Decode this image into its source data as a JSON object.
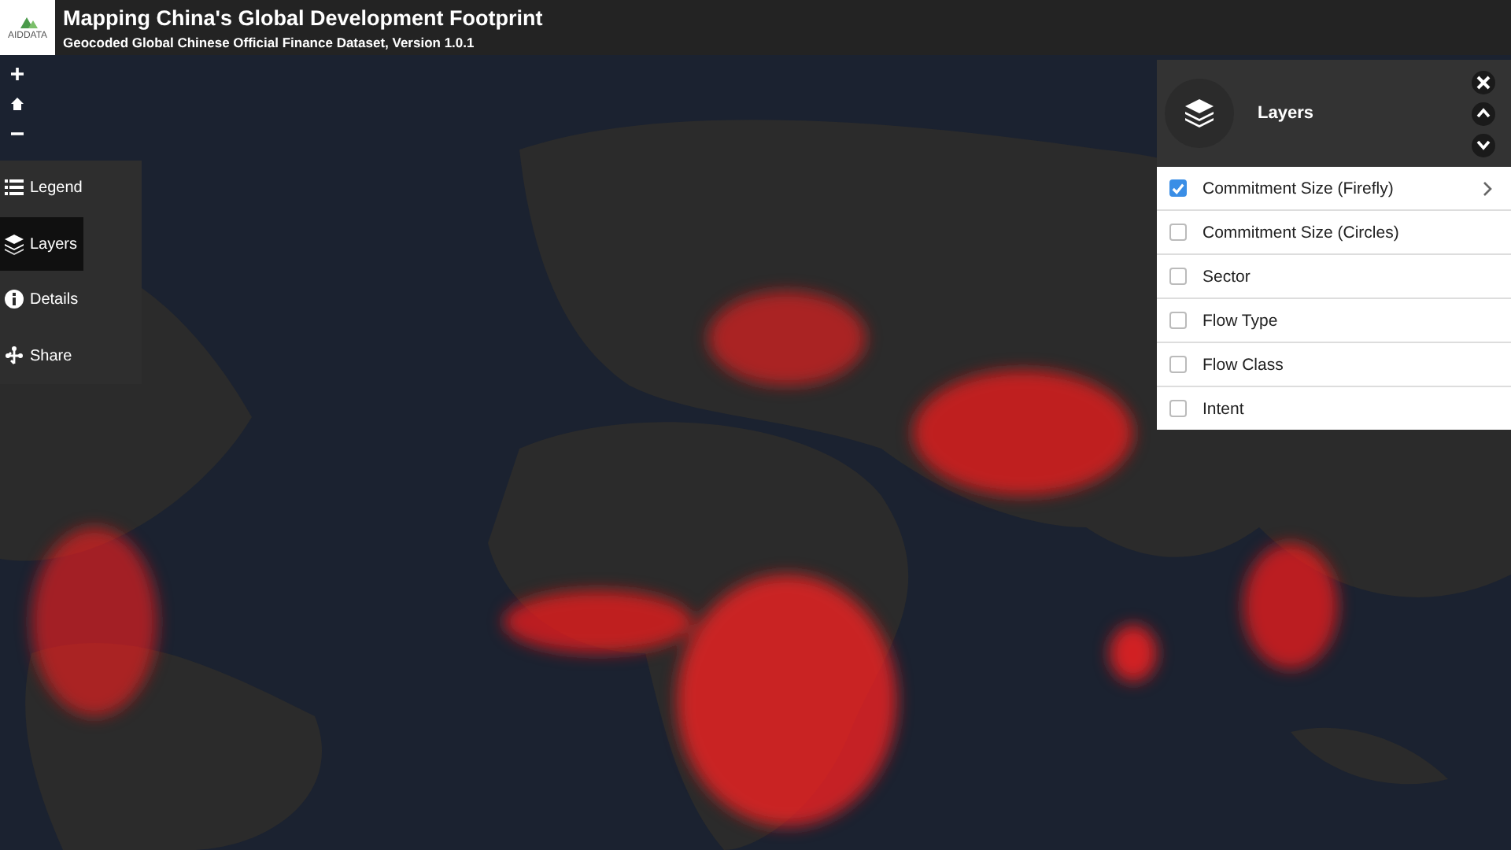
{
  "header": {
    "logo_text": "AIDDATA",
    "title": "Mapping China's Global Development Footprint",
    "subtitle": "Geocoded Global Chinese Official Finance Dataset, Version 1.0.1"
  },
  "sidebar": {
    "items": [
      {
        "label": "Legend",
        "selected": false
      },
      {
        "label": "Layers",
        "selected": true
      },
      {
        "label": "Details",
        "selected": false
      },
      {
        "label": "Share",
        "selected": false
      }
    ]
  },
  "layers_panel": {
    "title": "Layers",
    "items": [
      {
        "label": "Commitment Size (Firefly)",
        "checked": true,
        "expandable": true
      },
      {
        "label": "Commitment Size (Circles)",
        "checked": false,
        "expandable": false
      },
      {
        "label": "Sector",
        "checked": false,
        "expandable": false
      },
      {
        "label": "Flow Type",
        "checked": false,
        "expandable": false
      },
      {
        "label": "Flow Class",
        "checked": false,
        "expandable": false
      },
      {
        "label": "Intent",
        "checked": false,
        "expandable": false
      }
    ]
  }
}
